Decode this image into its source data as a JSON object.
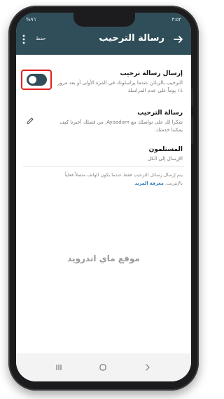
{
  "status_bar": {
    "time": "٣:٥٢",
    "system": "%٩٦"
  },
  "header": {
    "title": "رسالة الترحيب",
    "save_label": "حفظ",
    "icons": {
      "back": "arrow-right-icon",
      "more": "more-vertical-icon"
    }
  },
  "settings": {
    "send_greeting": {
      "title": "إرسال رسالة ترحيب",
      "subtitle_line1": "الترحيب بالزبائن عندما يراسلونك في المرة الأولى أو بعد مرور",
      "subtitle_line2": "١٤ يوماً على عدم المراسلة",
      "toggle_on": true
    },
    "greeting_message": {
      "title": "رسالة الترحيب",
      "subtitle_line1": "شكرا لك على تواصلك مع Ayaadam. من فضلك أخبرنا كيف",
      "subtitle_line2": "يمكننا خدمتك."
    },
    "recipients": {
      "title": "المستلمون",
      "subtitle": "الإرسال إلى الكل"
    }
  },
  "info": {
    "line1": "يتم إرسال رسائل الترحيب فقط عندما يكون الهاتف متصلاً فعلياً",
    "line2": "بالإنترنت.",
    "learn_more": "معرفة المزيد"
  },
  "watermark": "موقع ماي اندرويد",
  "colors": {
    "header": "#2f4e59",
    "accent": "#2b7bbd",
    "highlight": "#e02020"
  }
}
